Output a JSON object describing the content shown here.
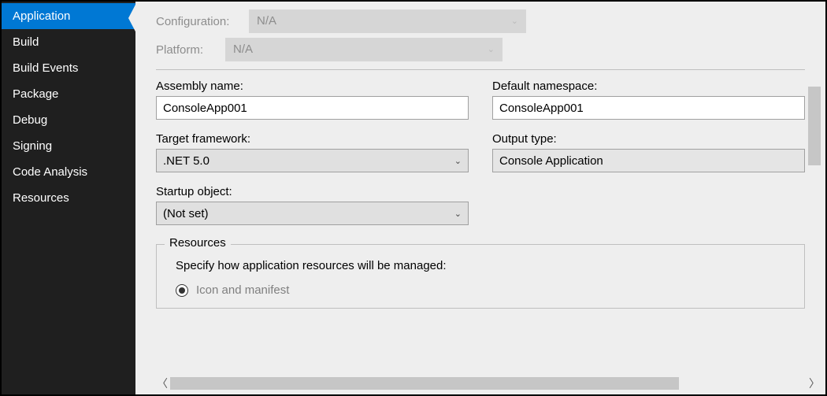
{
  "sidebar": {
    "items": [
      {
        "label": "Application",
        "selected": true
      },
      {
        "label": "Build",
        "selected": false
      },
      {
        "label": "Build Events",
        "selected": false
      },
      {
        "label": "Package",
        "selected": false
      },
      {
        "label": "Debug",
        "selected": false
      },
      {
        "label": "Signing",
        "selected": false
      },
      {
        "label": "Code Analysis",
        "selected": false
      },
      {
        "label": "Resources",
        "selected": false
      }
    ]
  },
  "top": {
    "configuration_label": "Configuration:",
    "configuration_value": "N/A",
    "platform_label": "Platform:",
    "platform_value": "N/A"
  },
  "form": {
    "assembly_name_label": "Assembly name:",
    "assembly_name_value": "ConsoleApp001",
    "default_namespace_label": "Default namespace:",
    "default_namespace_value": "ConsoleApp001",
    "target_framework_label": "Target framework:",
    "target_framework_value": ".NET 5.0",
    "output_type_label": "Output type:",
    "output_type_value": "Console Application",
    "startup_object_label": "Startup object:",
    "startup_object_value": "(Not set)"
  },
  "resources": {
    "legend": "Resources",
    "description": "Specify how application resources will be managed:",
    "radio_icon_manifest_label": "Icon and manifest"
  }
}
